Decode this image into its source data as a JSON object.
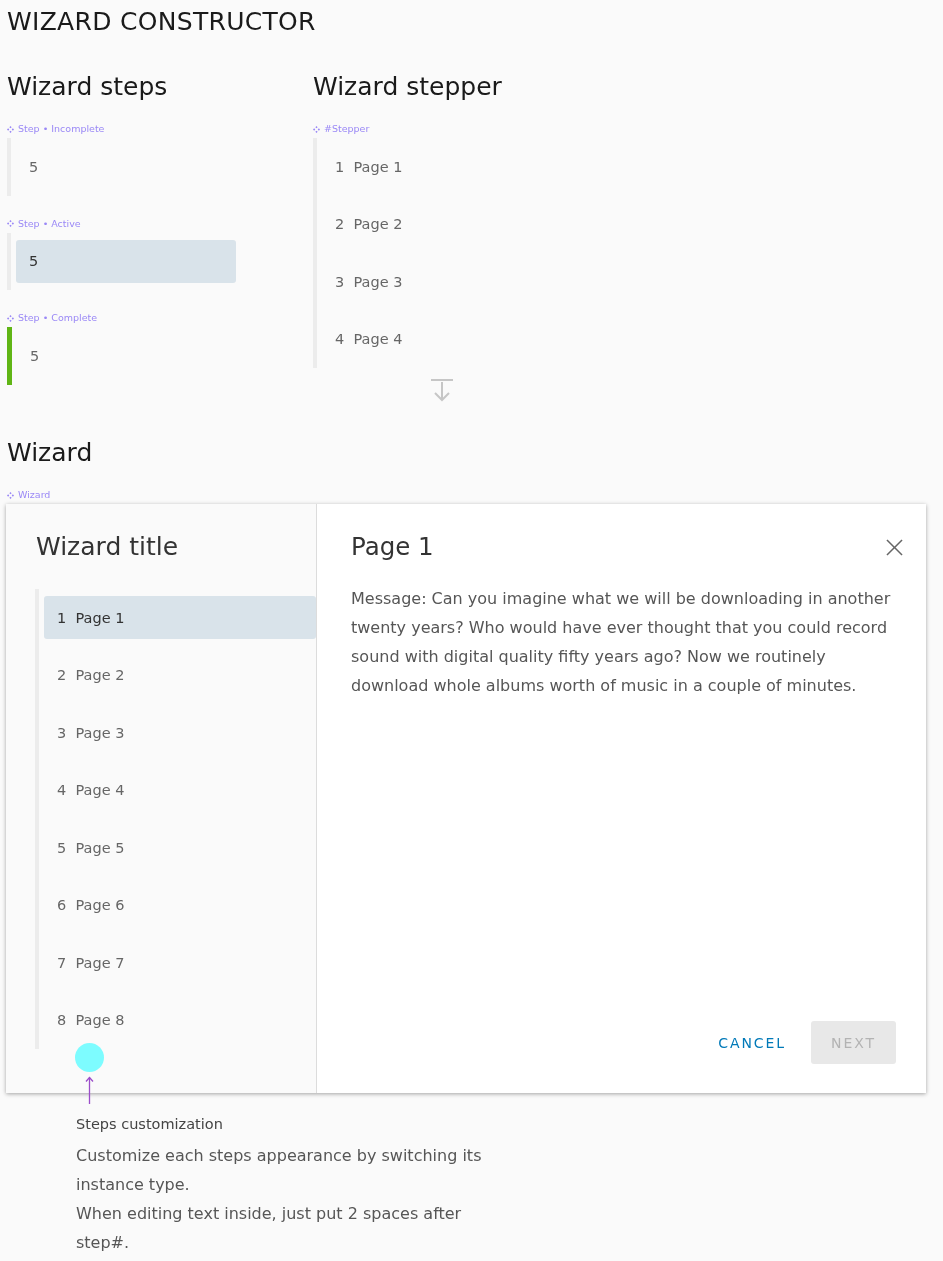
{
  "page": {
    "title": "WIZARD CONSTRUCTOR"
  },
  "wizard_steps": {
    "heading": "Wizard steps",
    "variants": [
      {
        "label": "Step • Incomplete",
        "number": "5",
        "selected": false,
        "complete": false
      },
      {
        "label": "Step • Active",
        "number": "5",
        "selected": true,
        "complete": false
      },
      {
        "label": "Step • Complete",
        "number": "5",
        "selected": false,
        "complete": true
      }
    ]
  },
  "wizard_stepper": {
    "heading": "Wizard stepper",
    "label": "#Stepper",
    "steps": [
      {
        "text": "1  Page 1",
        "selected": false
      },
      {
        "text": "2  Page 2",
        "selected": false
      },
      {
        "text": "3  Page 3",
        "selected": false
      },
      {
        "text": "4  Page 4",
        "selected": false
      }
    ]
  },
  "wizard": {
    "heading": "Wizard",
    "label": "Wizard",
    "title": "Wizard title",
    "steps": [
      {
        "text": "1  Page 1",
        "selected": true
      },
      {
        "text": "2  Page 2",
        "selected": false
      },
      {
        "text": "3  Page 3",
        "selected": false
      },
      {
        "text": "4  Page 4",
        "selected": false
      },
      {
        "text": "5  Page 5",
        "selected": false
      },
      {
        "text": "6  Page 6",
        "selected": false
      },
      {
        "text": "7  Page 7",
        "selected": false
      },
      {
        "text": "8  Page 8",
        "selected": false
      }
    ],
    "page_title": "Page 1",
    "message": "Message: Can you imagine what we will be downloading in another twenty years? Who would have ever thought that you could record sound with digital quality fifty years ago? Now we routinely download whole albums worth of music in a couple of minutes.",
    "buttons": [
      {
        "label": "CANCEL",
        "kind": "flat",
        "disabled": false
      },
      {
        "label": "NEXT",
        "kind": "solid",
        "disabled": true
      }
    ]
  },
  "annotation": {
    "title": "Steps customization",
    "paragraphs": [
      "Customize each steps appearance by switching its instance type.",
      "When editing text inside, just put 2 spaces after step#."
    ]
  }
}
